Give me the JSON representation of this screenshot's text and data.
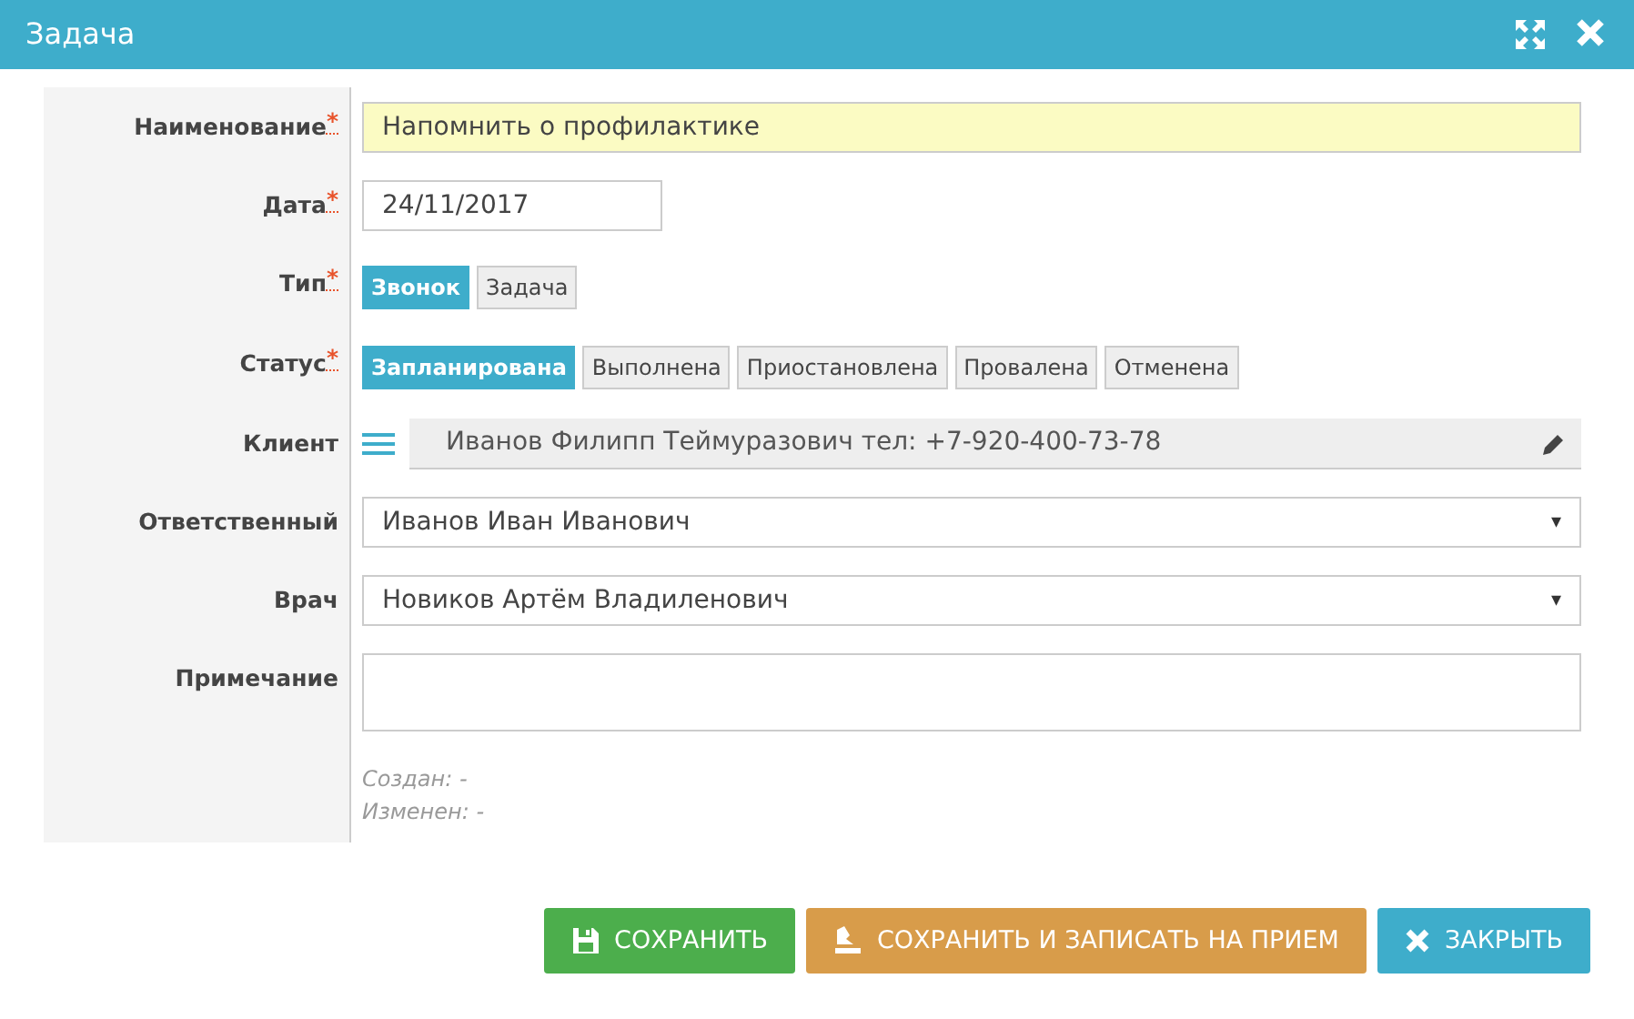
{
  "window": {
    "title": "Задача"
  },
  "fields": [
    {
      "kind": "text",
      "label": "Наименование",
      "required": true,
      "value": "Напомнить о профилактике",
      "highlighted": true
    },
    {
      "kind": "date",
      "label": "Дата",
      "required": true,
      "value": "24/11/2017"
    },
    {
      "kind": "toggle",
      "label": "Тип",
      "required": true,
      "options": [
        {
          "label": "Звонок",
          "selected": true
        },
        {
          "label": "Задача",
          "selected": false
        }
      ]
    },
    {
      "kind": "toggle",
      "label": "Статус",
      "required": true,
      "options": [
        {
          "label": "Запланирована",
          "selected": true
        },
        {
          "label": "Выполнена",
          "selected": false
        },
        {
          "label": "Приостановлена",
          "selected": false
        },
        {
          "label": "Провалена",
          "selected": false
        },
        {
          "label": "Отменена",
          "selected": false
        }
      ]
    },
    {
      "kind": "lookup",
      "label": "Клиент",
      "required": false,
      "value": "Иванов Филипп Теймуразович тел: +7-920-400-73-78"
    },
    {
      "kind": "select",
      "label": "Ответственный",
      "required": false,
      "value": "Иванов Иван Иванович"
    },
    {
      "kind": "select",
      "label": "Врач",
      "required": false,
      "value": "Новиков Артём Владиленович"
    },
    {
      "kind": "textarea",
      "label": "Примечание",
      "required": false
    }
  ],
  "meta": [
    "Создан: -",
    "Изменен: -"
  ],
  "required_mark": "*",
  "select_caret": "▾",
  "buttons": [
    {
      "kind": "save",
      "label": "СОХРАНИТЬ"
    },
    {
      "kind": "appointment",
      "label": "СОХРАНИТЬ И ЗАПИСАТЬ НА ПРИЕМ"
    },
    {
      "kind": "close",
      "label": "ЗАКРЫТЬ"
    }
  ]
}
